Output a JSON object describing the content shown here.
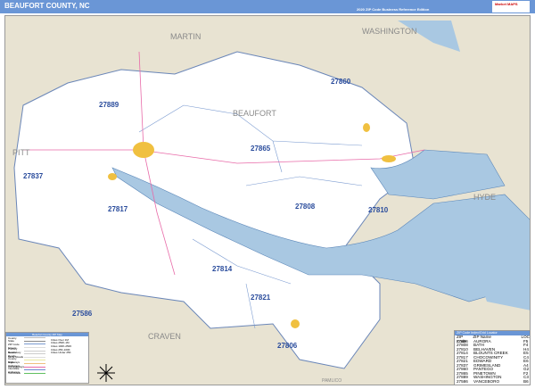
{
  "header": {
    "title": "BEAUFORT COUNTY, NC",
    "edition": "2020 ZIP Code Business Reference Edition",
    "logo": "Market MAPS"
  },
  "map": {
    "county_labels": [
      "MARTIN",
      "WASHINGTON",
      "BEAUFORT",
      "PITT",
      "HYDE",
      "PAMLICO",
      "CRAVEN"
    ],
    "zip_labels": [
      "27889",
      "27860",
      "27865",
      "27837",
      "27817",
      "27808",
      "27810",
      "27814",
      "27821",
      "27806",
      "27586"
    ],
    "colors": {
      "land": "#e8e3d2",
      "county": "#ffffff",
      "water": "#a9c8e2",
      "zip_label": "#2a4c9c",
      "city": "#f0c040"
    }
  },
  "legend": {
    "title": "Beaufort County ZIP Map",
    "items": [
      "County",
      "State",
      "ZIP Code",
      "Streets",
      "Primary Roads",
      "Secondary Roads",
      "Minor Roads",
      "County Highways",
      "State Highways",
      "US Highways",
      "Interstate Highways",
      "Toll Roads"
    ],
    "city_sizes": [
      "Cities Over 1M",
      "Cities 250K-1M",
      "Cities 100K-250K",
      "Cities 25K-100K",
      "Cities Under 25K"
    ]
  },
  "zip_table": {
    "title": "ZIP Code Index/Grid Locator",
    "headers": [
      "ZIP Code",
      "ZIP Name",
      "LOC"
    ],
    "rows": [
      [
        "27806",
        "AURORA",
        "F5"
      ],
      [
        "27808",
        "BATH",
        "F4"
      ],
      [
        "27810",
        "BELHAVEN",
        "H4"
      ],
      [
        "27814",
        "BLOUNTS CREEK",
        "E5"
      ],
      [
        "27817",
        "CHOCOWINITY",
        "C4"
      ],
      [
        "27821",
        "EDWARD",
        "E6"
      ],
      [
        "27837",
        "GRIMESLAND",
        "A4"
      ],
      [
        "27860",
        "PANTEGO",
        "G2"
      ],
      [
        "27865",
        "PINETOWN",
        "F2"
      ],
      [
        "27889",
        "WASHINGTON",
        "C3"
      ],
      [
        "27586",
        "VANCEBORO",
        "B6"
      ]
    ]
  }
}
